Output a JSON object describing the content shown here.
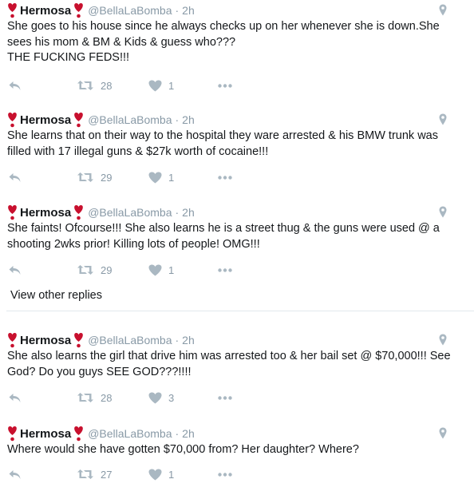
{
  "colors": {
    "heart": "#c8102e",
    "muted": "#8899a6",
    "text": "#14171a",
    "icon": "#aab8c2"
  },
  "tweets": [
    {
      "name": "Hermosa",
      "handle": "@BellaLaBomba",
      "separator": "·",
      "time": "2h",
      "text": "She goes to his house since he always checks up on her whenever she is down.She sees his mom & BM & Kids & guess who???\nTHE FUCKING FEDS!!!",
      "retweets": "28",
      "likes": "1"
    },
    {
      "name": "Hermosa",
      "handle": "@BellaLaBomba",
      "separator": "·",
      "time": "2h",
      "text": "She learns that on their way to the hospital they ware arrested & his BMW trunk was filled with 17 illegal guns & $27k worth of cocaine!!!",
      "retweets": "29",
      "likes": "1"
    },
    {
      "name": "Hermosa",
      "handle": "@BellaLaBomba",
      "separator": "·",
      "time": "2h",
      "text": "She faints! Ofcourse!!! She also learns he is a street thug & the guns were used @ a shooting 2wks prior! Killing lots of people! OMG!!!",
      "retweets": "29",
      "likes": "1"
    },
    {
      "name": "Hermosa",
      "handle": "@BellaLaBomba",
      "separator": "·",
      "time": "2h",
      "text": "She also learns the girl that drive him was arrested too & her bail set @ $70,000!!! See God? Do you guys SEE GOD???!!!!",
      "retweets": "28",
      "likes": "3"
    },
    {
      "name": "Hermosa",
      "handle": "@BellaLaBomba",
      "separator": "·",
      "time": "2h",
      "text": "Where would she have gotten $70,000 from? Her daughter? Where?",
      "retweets": "27",
      "likes": "1"
    }
  ],
  "view_other_replies": "View other replies",
  "icons": {
    "name_emoji": "heart-exclamation-icon",
    "geo": "location-pin-icon",
    "reply": "reply-icon",
    "retweet": "retweet-icon",
    "like": "like-heart-icon",
    "more": "more-dots-icon"
  }
}
